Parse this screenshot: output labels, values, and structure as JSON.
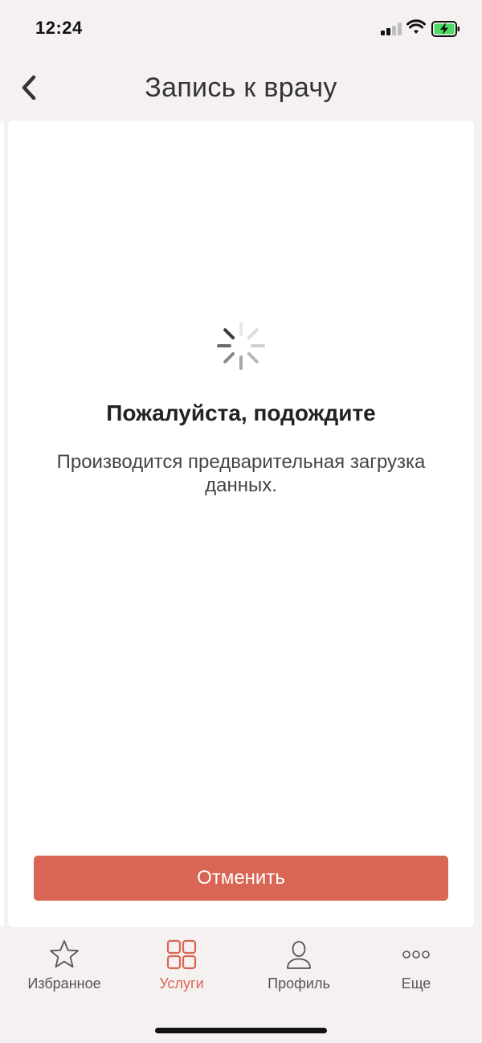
{
  "status_bar": {
    "time": "12:24"
  },
  "nav": {
    "title": "Запись к врачу",
    "back_icon": "chevron-left-icon"
  },
  "loading": {
    "title": "Пожалуйста, подождите",
    "message": "Производится предварительная загрузка данных."
  },
  "actions": {
    "cancel_label": "Отменить"
  },
  "tabs": [
    {
      "label": "Избранное",
      "icon": "star-icon",
      "active": false
    },
    {
      "label": "Услуги",
      "icon": "grid-icon",
      "active": true
    },
    {
      "label": "Профиль",
      "icon": "profile-icon",
      "active": false
    },
    {
      "label": "Еще",
      "icon": "more-icon",
      "active": false
    }
  ],
  "colors": {
    "accent": "#d96554",
    "background": "#f5f1f0",
    "card": "#ffffff"
  }
}
